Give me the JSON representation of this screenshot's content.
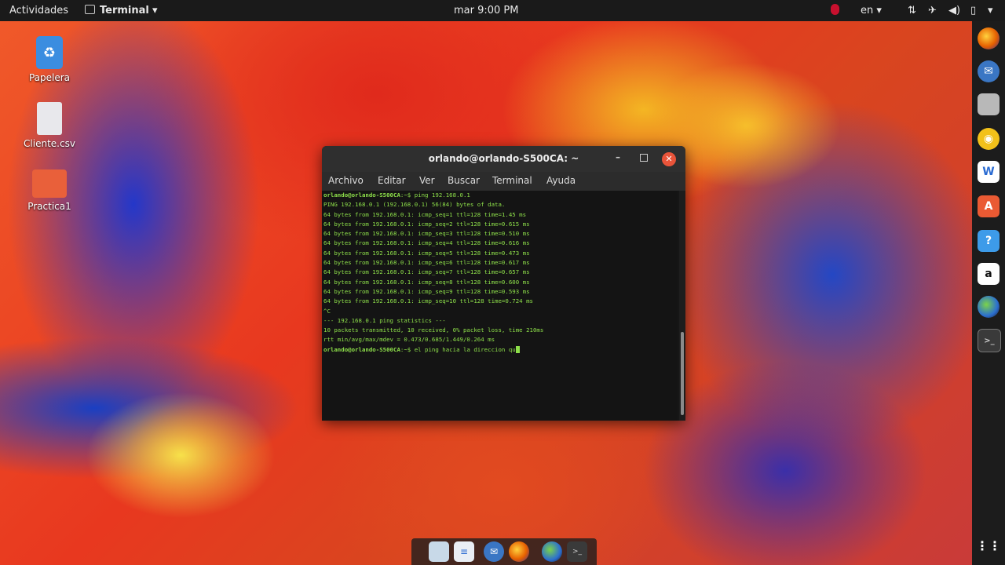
{
  "topbar": {
    "activities": "Actividades",
    "app_menu": "Terminal",
    "clock": "mar  9:00 PM",
    "language": "en"
  },
  "desktop": {
    "icons": [
      {
        "label": "Papelera",
        "icon": "trash-icon"
      },
      {
        "label": "Cliente.csv",
        "icon": "file-icon"
      },
      {
        "label": "Practica1",
        "icon": "folder-icon"
      }
    ]
  },
  "dock": {
    "apps": [
      "firefox-icon",
      "thunderbird-icon",
      "files-icon",
      "rhythmbox-icon",
      "libreoffice-writer-icon",
      "software-center-icon",
      "help-icon",
      "amazon-icon",
      "browser-icon",
      "terminal-icon"
    ],
    "show_apps": "grid-icon"
  },
  "terminal": {
    "title": "orlando@orlando-S500CA: ~",
    "menu": [
      "Archivo",
      "Editar",
      "Ver",
      "Buscar",
      "Terminal",
      "Ayuda"
    ],
    "lines": [
      {
        "prompt": "orlando@orlando-S500CA",
        "text": ":~$ ping 192.168.0.1"
      },
      {
        "prompt": "",
        "text": "PING 192.168.0.1 (192.168.0.1) 56(84) bytes of data."
      },
      {
        "prompt": "",
        "text": "64 bytes from 192.168.0.1: icmp_seq=1 ttl=128 time=1.45 ms"
      },
      {
        "prompt": "",
        "text": "64 bytes from 192.168.0.1: icmp_seq=2 ttl=128 time=0.615 ms"
      },
      {
        "prompt": "",
        "text": "64 bytes from 192.168.0.1: icmp_seq=3 ttl=128 time=0.510 ms"
      },
      {
        "prompt": "",
        "text": "64 bytes from 192.168.0.1: icmp_seq=4 ttl=128 time=0.616 ms"
      },
      {
        "prompt": "",
        "text": "64 bytes from 192.168.0.1: icmp_seq=5 ttl=128 time=0.473 ms"
      },
      {
        "prompt": "",
        "text": "64 bytes from 192.168.0.1: icmp_seq=6 ttl=128 time=0.617 ms"
      },
      {
        "prompt": "",
        "text": "64 bytes from 192.168.0.1: icmp_seq=7 ttl=128 time=0.657 ms"
      },
      {
        "prompt": "",
        "text": "64 bytes from 192.168.0.1: icmp_seq=8 ttl=128 time=0.600 ms"
      },
      {
        "prompt": "",
        "text": "64 bytes from 192.168.0.1: icmp_seq=9 ttl=128 time=0.593 ms"
      },
      {
        "prompt": "",
        "text": "64 bytes from 192.168.0.1: icmp_seq=10 ttl=128 time=0.724 ms"
      },
      {
        "prompt": "",
        "text": "^C"
      },
      {
        "prompt": "",
        "text": "--- 192.168.0.1 ping statistics ---"
      },
      {
        "prompt": "",
        "text": "10 packets transmitted, 10 received, 0% packet loss, time 210ms"
      },
      {
        "prompt": "",
        "text": "rtt min/avg/max/mdev = 0.473/0.685/1.449/0.264 ms"
      },
      {
        "prompt": "orlando@orlando-S500CA",
        "text": ":~$ el ping hacia la direccion qu"
      }
    ]
  }
}
